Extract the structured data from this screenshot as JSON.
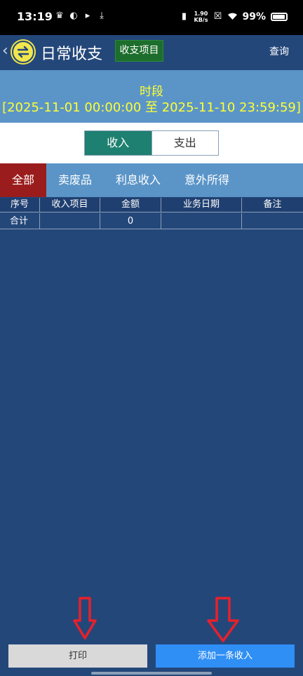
{
  "status_bar": {
    "time": "13:19",
    "speed_value": "1.90",
    "speed_unit": "KB/s",
    "battery": "99%"
  },
  "header": {
    "title": "日常收支",
    "items_button": "收支项目",
    "query_button": "查询"
  },
  "period": {
    "title": "时段",
    "range": "[2025-11-01 00:00:00 至 2025-11-10 23:59:59]"
  },
  "toggle": {
    "income": "收入",
    "expense": "支出",
    "selected": "income"
  },
  "tabs": [
    {
      "label": "全部"
    },
    {
      "label": "卖废品"
    },
    {
      "label": "利息收入"
    },
    {
      "label": "意外所得"
    }
  ],
  "table": {
    "columns": [
      "序号",
      "收入项目",
      "金额",
      "业务日期",
      "备注"
    ],
    "total_row": [
      "合计",
      "",
      "0",
      "",
      ""
    ]
  },
  "buttons": {
    "print": "打印",
    "add": "添加一条收入"
  },
  "colors": {
    "background": "#24477a",
    "period_bg": "#5b95c8",
    "period_text": "#ffff33",
    "active_toggle": "#1e8070",
    "active_tab": "#9b1c1c",
    "items_button": "#1d6e2c",
    "add_button": "#2f8ff5",
    "arrow": "#e8202a"
  }
}
